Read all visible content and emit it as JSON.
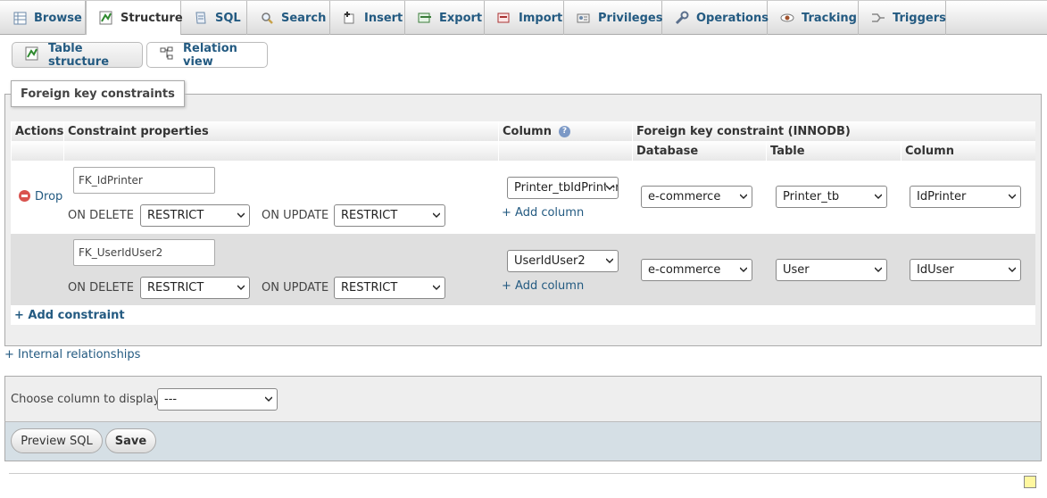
{
  "tabs": [
    {
      "label": "Browse",
      "icon": "table-browse-icon"
    },
    {
      "label": "Structure",
      "icon": "structure-icon",
      "active": true
    },
    {
      "label": "SQL",
      "icon": "sql-icon"
    },
    {
      "label": "Search",
      "icon": "search-icon"
    },
    {
      "label": "Insert",
      "icon": "insert-icon"
    },
    {
      "label": "Export",
      "icon": "export-icon"
    },
    {
      "label": "Import",
      "icon": "import-icon"
    },
    {
      "label": "Privileges",
      "icon": "privileges-icon"
    },
    {
      "label": "Operations",
      "icon": "wrench-icon"
    },
    {
      "label": "Tracking",
      "icon": "eye-icon"
    },
    {
      "label": "Triggers",
      "icon": "triggers-icon"
    }
  ],
  "subtabs": {
    "table_structure": "Table structure",
    "relation_view": "Relation view"
  },
  "fk_section": {
    "legend": "Foreign key constraints",
    "headers": {
      "actions": "Actions",
      "constraint_properties": "Constraint properties",
      "column": "Column",
      "foreign_key": "Foreign key constraint (INNODB)",
      "database": "Database",
      "table": "Table",
      "fk_column": "Column"
    },
    "drop_label": "Drop",
    "on_delete_label": "ON DELETE",
    "on_update_label": "ON UPDATE",
    "add_column_label": "+ Add column",
    "add_constraint_label": "+ Add constraint",
    "rows": [
      {
        "name": "FK_IdPrinter",
        "on_delete": "RESTRICT",
        "on_update": "RESTRICT",
        "column": "Printer_tbIdPrinter",
        "database": "e-commerce",
        "table": "Printer_tb",
        "fk_column": "IdPrinter"
      },
      {
        "name": "FK_UserIdUser2",
        "on_delete": "RESTRICT",
        "on_update": "RESTRICT",
        "column": "UserIdUser2",
        "database": "e-commerce",
        "table": "User",
        "fk_column": "IdUser"
      }
    ]
  },
  "internal_relationships_label": "+ Internal relationships",
  "display_column": {
    "label": "Choose column to display:",
    "value": "---"
  },
  "buttons": {
    "preview_sql": "Preview SQL",
    "save": "Save"
  },
  "colors": {
    "link": "#235a81",
    "panel_bg": "#eeeeee",
    "footer_bg": "#d5dfe5"
  }
}
